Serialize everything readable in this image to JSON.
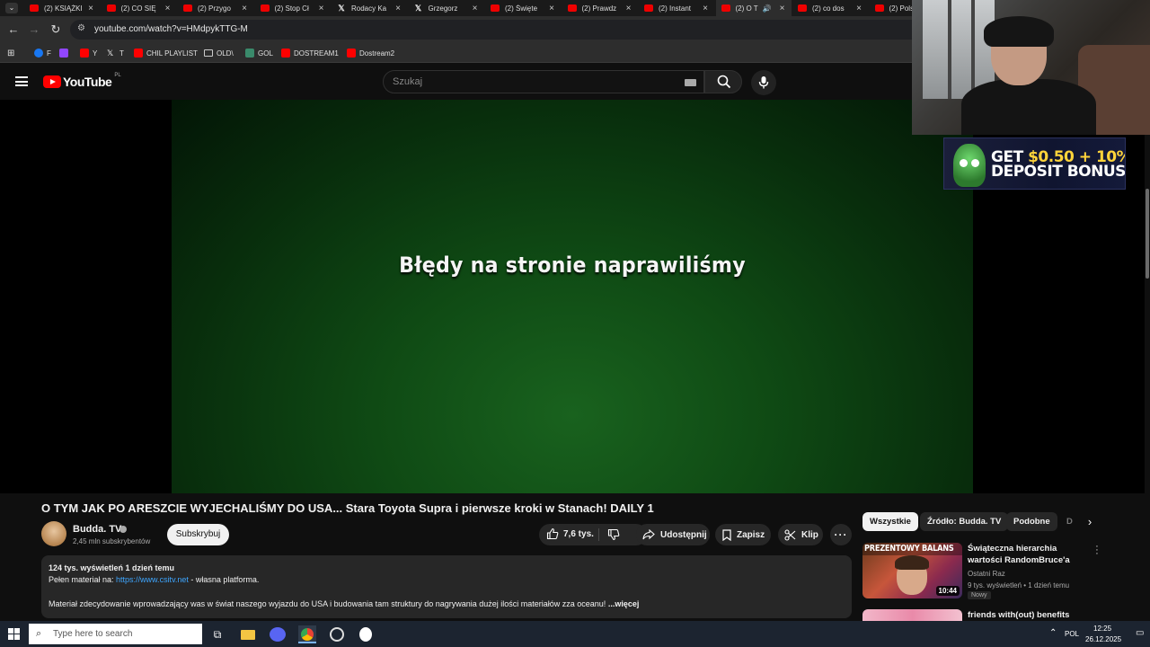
{
  "browser": {
    "tabs": [
      {
        "label": "(2) KSIĄŻKI",
        "icon": "youtube-icon"
      },
      {
        "label": "(2) CO SIĘ",
        "icon": "youtube-icon"
      },
      {
        "label": "(2) Przygo",
        "icon": "youtube-icon"
      },
      {
        "label": "(2) Stop Cł",
        "icon": "youtube-icon"
      },
      {
        "label": "Rodacy Ka",
        "icon": "x-icon"
      },
      {
        "label": "Grzegorz ",
        "icon": "x-icon"
      },
      {
        "label": "(2) Święte",
        "icon": "youtube-icon"
      },
      {
        "label": "(2) Prawdz",
        "icon": "youtube-icon"
      },
      {
        "label": "(2) Instant",
        "icon": "youtube-icon"
      },
      {
        "label": "(2) O T",
        "icon": "youtube-icon"
      },
      {
        "label": "(2) co dos",
        "icon": "youtube-icon"
      },
      {
        "label": "(2) Pols",
        "icon": "youtube-icon"
      }
    ],
    "url": "youtube.com/watch?v=HMdpykTTG-M",
    "bookmarks": [
      {
        "label": "F",
        "icon": "facebook-icon"
      },
      {
        "label": "",
        "icon": "twitch-icon"
      },
      {
        "label": "Y",
        "icon": "youtube-icon"
      },
      {
        "label": "T",
        "icon": "x-icon"
      },
      {
        "label": "CHIL PLAYLIST",
        "icon": "youtube-icon"
      },
      {
        "label": "OLD\\",
        "icon": "folder-icon"
      },
      {
        "label": "GOL",
        "icon": "gol-icon"
      },
      {
        "label": "DOSTREAM1",
        "icon": "youtube-icon"
      },
      {
        "label": "Dostream2",
        "icon": "youtube-icon"
      }
    ]
  },
  "youtube": {
    "logo_text": "YouTube",
    "region": "PL",
    "search_placeholder": "Szukaj"
  },
  "video": {
    "overlay_text": "Błędy na stronie naprawiliśmy",
    "title": "O TYM JAK PO ARESZCIE WYJECHALIŚMY DO USA... Stara Toyota Supra i pierwsze kroki w Stanach! DAILY 1",
    "channel": "Budda. TV",
    "subscribers": "2,45 mln subskrybentów",
    "subscribe_label": "Subskrybuj",
    "likes": "7,6 tys.",
    "share_label": "Udostępnij",
    "save_label": "Zapisz",
    "clip_label": "Klip",
    "description": {
      "stats": "124 tys. wyświetleń  1 dzień temu",
      "line2_prefix": "Pełen materiał na: ",
      "line2_link": "https://www.csitv.net",
      "line2_suffix": " - własna platforma.",
      "line3": "Materiał zdecydowanie wprowadzający was w świat naszego wyjazdu do USA i budowania tam struktury do nagrywania dużej ilości materiałów zza oceanu!",
      "more": "...więcej"
    }
  },
  "ad": {
    "line1_prefix": "GET ",
    "line1_amount": "$0.50 + 10%",
    "line2": "DEPOSIT BONUS"
  },
  "sidebar": {
    "chips": [
      "Wszystkie",
      "Źródło: Budda. TV",
      "Podobne",
      "D"
    ],
    "recommendations": [
      {
        "thumb_text": "PREZENTOWY BALANS",
        "title": "Świąteczna hierarchia wartości RandomBruce'a",
        "channel": "Ostatni Raz",
        "meta": "9 tys. wyświetleń • 1 dzień temu",
        "badge": "Nowy",
        "duration": "10:44"
      },
      {
        "title": "friends with(out) benefits"
      }
    ]
  },
  "taskbar": {
    "search_placeholder": "Type here to search",
    "language": "POL",
    "time": "12:25",
    "date": "26.12.2025"
  }
}
